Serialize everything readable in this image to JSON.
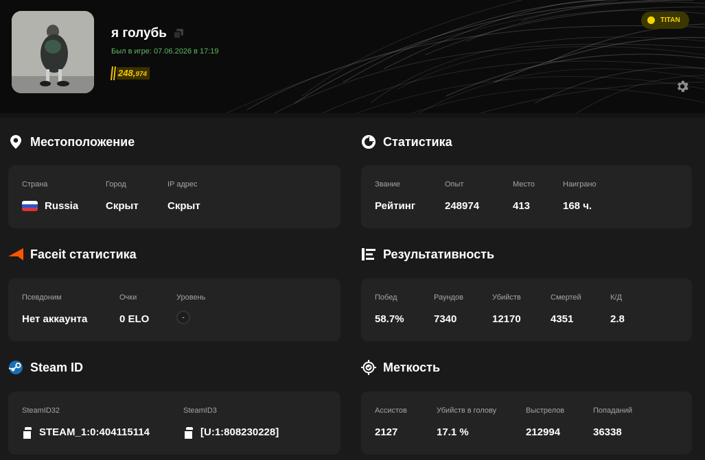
{
  "profile": {
    "username": "я голубь",
    "last_seen": "Был в игре: 07.06.2026 в 17:19",
    "points_main": "248,",
    "points_small": "974",
    "badge": "TITAN",
    "accent_color": "#f5d300"
  },
  "location": {
    "title": "Местоположение",
    "country_label": "Страна",
    "country_value": "Russia",
    "city_label": "Город",
    "city_value": "Скрыт",
    "ip_label": "IP адрес",
    "ip_value": "Скрыт"
  },
  "stats": {
    "title": "Статистика",
    "rank_label": "Звание",
    "rank_value": "Рейтинг",
    "xp_label": "Опыт",
    "xp_value": "248974",
    "place_label": "Место",
    "place_value": "413",
    "played_label": "Наиграно",
    "played_value": "168 ч."
  },
  "faceit": {
    "title": "Faceit статистика",
    "nick_label": "Псевдоним",
    "nick_value": "Нет аккаунта",
    "points_label": "Очки",
    "points_value": "0 ELO",
    "level_label": "Уровень",
    "level_value": "-"
  },
  "performance": {
    "title": "Результативность",
    "wins_label": "Побед",
    "wins_value": "58.7%",
    "rounds_label": "Раундов",
    "rounds_value": "7340",
    "kills_label": "Убийств",
    "kills_value": "12170",
    "deaths_label": "Смертей",
    "deaths_value": "4351",
    "kd_label": "К/Д",
    "kd_value": "2.8"
  },
  "steam": {
    "title": "Steam ID",
    "id32_label": "SteamID32",
    "id32_value": "STEAM_1:0:404115114",
    "id3_label": "SteamID3",
    "id3_value": "[U:1:808230228]"
  },
  "accuracy": {
    "title": "Меткость",
    "assists_label": "Ассистов",
    "assists_value": "2127",
    "hs_label": "Убийств в голову",
    "hs_value": "17.1 %",
    "shots_label": "Выстрелов",
    "shots_value": "212994",
    "hits_label": "Попаданий",
    "hits_value": "36338"
  },
  "icons": {
    "location": "map-pin-icon",
    "stats": "pie-chart-icon",
    "faceit": "faceit-logo-icon",
    "performance": "list-bars-icon",
    "steam": "steam-logo-icon",
    "accuracy": "crosshair-icon",
    "settings": "gear-icon",
    "copy": "copy-icon"
  }
}
